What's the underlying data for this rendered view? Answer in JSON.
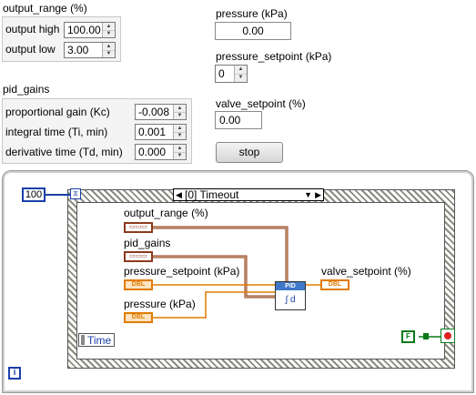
{
  "front_panel": {
    "output_range": {
      "title": "output_range (%)",
      "high_label": "output high",
      "high_value": "100.00",
      "low_label": "output low",
      "low_value": "3.00"
    },
    "pid_gains": {
      "title": "pid_gains",
      "kc_label": "proportional gain (Kc)",
      "kc_value": "-0.008",
      "ti_label": "integral time (Ti, min)",
      "ti_value": "0.001",
      "td_label": "derivative time (Td, min)",
      "td_value": "0.000"
    },
    "pressure": {
      "label": "pressure (kPa)",
      "value": "0.00"
    },
    "pressure_setpoint": {
      "label": "pressure_setpoint (kPa)",
      "value": "0"
    },
    "valve_setpoint": {
      "label": "valve_setpoint (%)",
      "value": "0.00"
    },
    "stop_button": {
      "label": "stop"
    }
  },
  "block_diagram": {
    "timeout_constant": "100",
    "case_selector": "[0] Timeout",
    "left_node": "Time",
    "iteration_terminal": "i",
    "stop_terminal": "F",
    "pid_vi_label": "PID",
    "terminals": {
      "output_range": {
        "label": "output_range (%)",
        "type": "   "
      },
      "pid_gains": {
        "label": "pid_gains"
      },
      "pressure_setpoint": {
        "label": "pressure_setpoint (kPa)",
        "type": "DBL"
      },
      "pressure": {
        "label": "pressure (kPa)",
        "type": "DBL"
      },
      "valve_setpoint": {
        "label": "valve_setpoint (%)",
        "type": "DBL"
      }
    },
    "colors": {
      "dbl_orange": "#e07b00",
      "cluster_brown": "#8b3a1e",
      "int_blue": "#1a3fa8",
      "bool_green": "#0a7a1a"
    }
  }
}
